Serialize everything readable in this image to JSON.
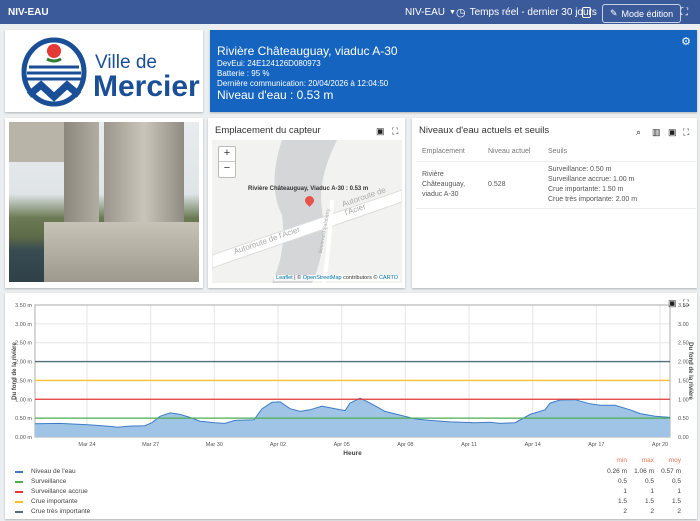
{
  "topbar": {
    "app_title": "NIV-EAU",
    "dashboard_select": "NIV-EAU",
    "time_range": "Temps réel - dernier 30 jours",
    "edit_mode": "Mode édition"
  },
  "logo": {
    "line1": "Ville de",
    "line2": "Mercier"
  },
  "sensor": {
    "name": "Rivière Châteauguay, viaduc A-30",
    "deveui": "DevEui: 24E124126D080973",
    "battery": "Batterie : 95 %",
    "last_comm": "Dernière communication: 20/04/2026 à 12:04:50",
    "level": "Niveau d'eau : 0.53 m"
  },
  "map": {
    "title": "Emplacement du capteur",
    "zoom_in": "+",
    "zoom_out": "−",
    "popup": "Rivière Châteauguay, Viaduc A-30 : 0.53 m",
    "road1": "Autoroute de l'Acier",
    "road2": "Autoroute de l'Acier",
    "road3": "Boulevard Salaberry",
    "attr_leaflet": "Leaflet",
    "attr_sep": " | © ",
    "attr_osm": "OpenStreetMap",
    "attr_mid": " contributors © ",
    "attr_carto": "CARTO"
  },
  "table": {
    "title": "Niveaux d'eau actuels et seuils",
    "headers": [
      "Emplacement",
      "Niveau actuel",
      "Seuils"
    ],
    "row": {
      "location": "Rivière Châteauguay, viaduc A-30",
      "level": "0.528",
      "thresholds": [
        "Surveillance: 0.50 m",
        "Surveillance accrue: 1.00 m",
        "Crue importante: 1.50 m",
        "Crue très importante: 2.00 m"
      ]
    }
  },
  "chart_data": {
    "type": "area",
    "xlabel": "Heure",
    "ylabel": "Du fond de la rivière",
    "ylabel_right": "Du fond de la rivière",
    "x_unit": "days since 2026-03-01",
    "xlim": [
      20.55,
      50.47
    ],
    "ylim": [
      0,
      3.5
    ],
    "x_ticks": [
      {
        "x": 23,
        "label": "Mar 24"
      },
      {
        "x": 26,
        "label": "Mar 27"
      },
      {
        "x": 29,
        "label": "Mar 30"
      },
      {
        "x": 32,
        "label": "Apr 02"
      },
      {
        "x": 35,
        "label": "Apr 05"
      },
      {
        "x": 38,
        "label": "Apr 08"
      },
      {
        "x": 41,
        "label": "Apr 11"
      },
      {
        "x": 44,
        "label": "Apr 14"
      },
      {
        "x": 47,
        "label": "Apr 17"
      },
      {
        "x": 50,
        "label": "Apr 20"
      }
    ],
    "y_ticks": [
      {
        "v": 0,
        "label": "0.00 m",
        "r": "0.00"
      },
      {
        "v": 0.5,
        "label": "0.50 m",
        "r": "0.50"
      },
      {
        "v": 1,
        "label": "1.00 m",
        "r": "1.00"
      },
      {
        "v": 1.5,
        "label": "1.50 m",
        "r": "1.50"
      },
      {
        "v": 2,
        "label": "2.00 m",
        "r": "2.00"
      },
      {
        "v": 2.5,
        "label": "2.50 m",
        "r": "2.50"
      },
      {
        "v": 3,
        "label": "3.00 m",
        "r": "3.00"
      },
      {
        "v": 3.5,
        "label": "3.50 m",
        "r": "3.50"
      }
    ],
    "series_water": {
      "name": "Niveau de l'eau",
      "color": "#3d7cc9",
      "x": [
        20.55,
        21.73,
        23.14,
        24.08,
        24.46,
        25.03,
        25.73,
        26.06,
        26.44,
        26.91,
        27.38,
        27.85,
        28.33,
        29.03,
        29.5,
        29.97,
        30.87,
        31.25,
        31.72,
        32.1,
        32.57,
        33.04,
        33.51,
        34.07,
        34.69,
        35.16,
        35.39,
        35.87,
        36.34,
        37.04,
        37.75,
        38.46,
        39.16,
        40.11,
        41.28,
        41.99,
        42.46,
        43.17,
        43.88,
        44.58,
        44.82,
        45.29,
        46.0,
        46.7,
        47.18,
        47.88,
        48.59,
        49.06,
        49.77,
        50.47
      ],
      "y": [
        0.35,
        0.36,
        0.32,
        0.28,
        0.26,
        0.29,
        0.3,
        0.38,
        0.55,
        0.64,
        0.6,
        0.52,
        0.42,
        0.38,
        0.36,
        0.44,
        0.46,
        0.75,
        0.92,
        0.93,
        0.75,
        0.68,
        0.72,
        0.82,
        0.75,
        0.7,
        0.9,
        1.03,
        0.9,
        0.68,
        0.58,
        0.48,
        0.44,
        0.4,
        0.38,
        0.39,
        0.36,
        0.38,
        0.6,
        0.72,
        0.9,
        0.98,
        0.99,
        0.88,
        0.84,
        0.84,
        0.72,
        0.62,
        0.55,
        0.52
      ]
    },
    "thresholds": [
      {
        "name": "Surveillance",
        "value": 0.5,
        "color": "#4caf50"
      },
      {
        "name": "Surveillance accrue",
        "value": 1,
        "color": "#e53935"
      },
      {
        "name": "Crue importante",
        "value": 1.5,
        "color": "#fbc02d"
      },
      {
        "name": "Crue très importante",
        "value": 2,
        "color": "#546e7a"
      }
    ],
    "legend_headers": [
      "min",
      "max",
      "moy"
    ],
    "legend": [
      {
        "name": "Niveau de l'eau",
        "color": "#3d7cc9",
        "min": "0.26 m",
        "max": "1.06 m",
        "moy": "0.57 m"
      },
      {
        "name": "Surveillance",
        "color": "#4caf50",
        "min": "0.5",
        "max": "0.5",
        "moy": "0.5"
      },
      {
        "name": "Surveillance accrue",
        "color": "#e53935",
        "min": "1",
        "max": "1",
        "moy": "1"
      },
      {
        "name": "Crue importante",
        "color": "#fbc02d",
        "min": "1.5",
        "max": "1.5",
        "moy": "1.5"
      },
      {
        "name": "Crue très importante",
        "color": "#546e7a",
        "min": "2",
        "max": "2",
        "moy": "2"
      }
    ]
  }
}
